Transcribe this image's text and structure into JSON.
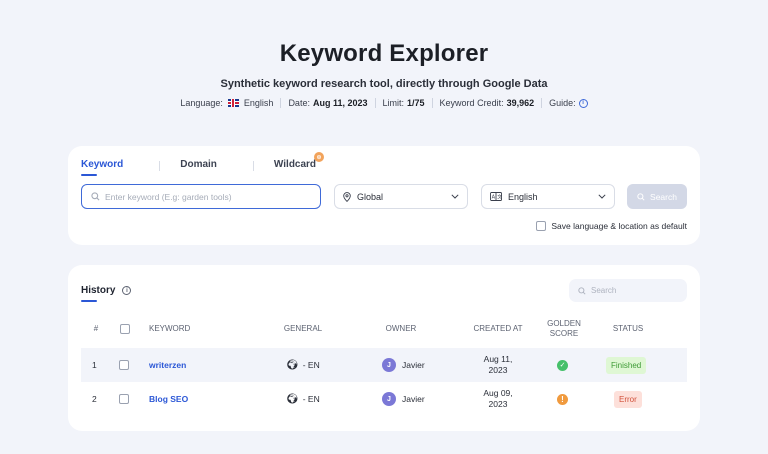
{
  "header": {
    "title": "Keyword Explorer",
    "subtitle": "Synthetic keyword research tool, directly through Google Data",
    "language_label": "Language:",
    "language_value": "English",
    "date_label": "Date:",
    "date_value": "Aug 11, 2023",
    "limit_label": "Limit:",
    "limit_value": "1/75",
    "credit_label": "Keyword Credit:",
    "credit_value": "39,962",
    "guide_label": "Guide:"
  },
  "search_panel": {
    "tabs": [
      {
        "label": "Keyword",
        "active": true
      },
      {
        "label": "Domain",
        "active": false
      },
      {
        "label": "Wildcard",
        "active": false
      }
    ],
    "wildcard_badge_icon": "coin-icon",
    "keyword_placeholder": "Enter keyword (E.g: garden tools)",
    "location_value": "Global",
    "language_value": "English",
    "search_button": "Search",
    "save_default_label": "Save language & location as default",
    "save_default_checked": false
  },
  "history": {
    "title": "History",
    "search_placeholder": "Search",
    "columns": {
      "num": "#",
      "keyword": "KEYWORD",
      "general": "GENERAL",
      "owner": "OWNER",
      "created_at": "CREATED AT",
      "golden_score_1": "GOLDEN",
      "golden_score_2": "SCORE",
      "status": "STATUS"
    },
    "rows": [
      {
        "num": "1",
        "keyword": "writerzen",
        "general": "- EN",
        "owner_initial": "J",
        "owner": "Javier",
        "created_1": "Aug 11,",
        "created_2": "2023",
        "golden": "ok",
        "status": "Finished"
      },
      {
        "num": "2",
        "keyword": "Blog SEO",
        "general": "- EN",
        "owner_initial": "J",
        "owner": "Javier",
        "created_1": "Aug 09,",
        "created_2": "2023",
        "golden": "warning",
        "status": "Error"
      }
    ]
  },
  "colors": {
    "accent": "#2b57d6",
    "finished_bg": "#dff7d4",
    "error_bg": "#fde0da",
    "avatar": "#7b78d6"
  }
}
